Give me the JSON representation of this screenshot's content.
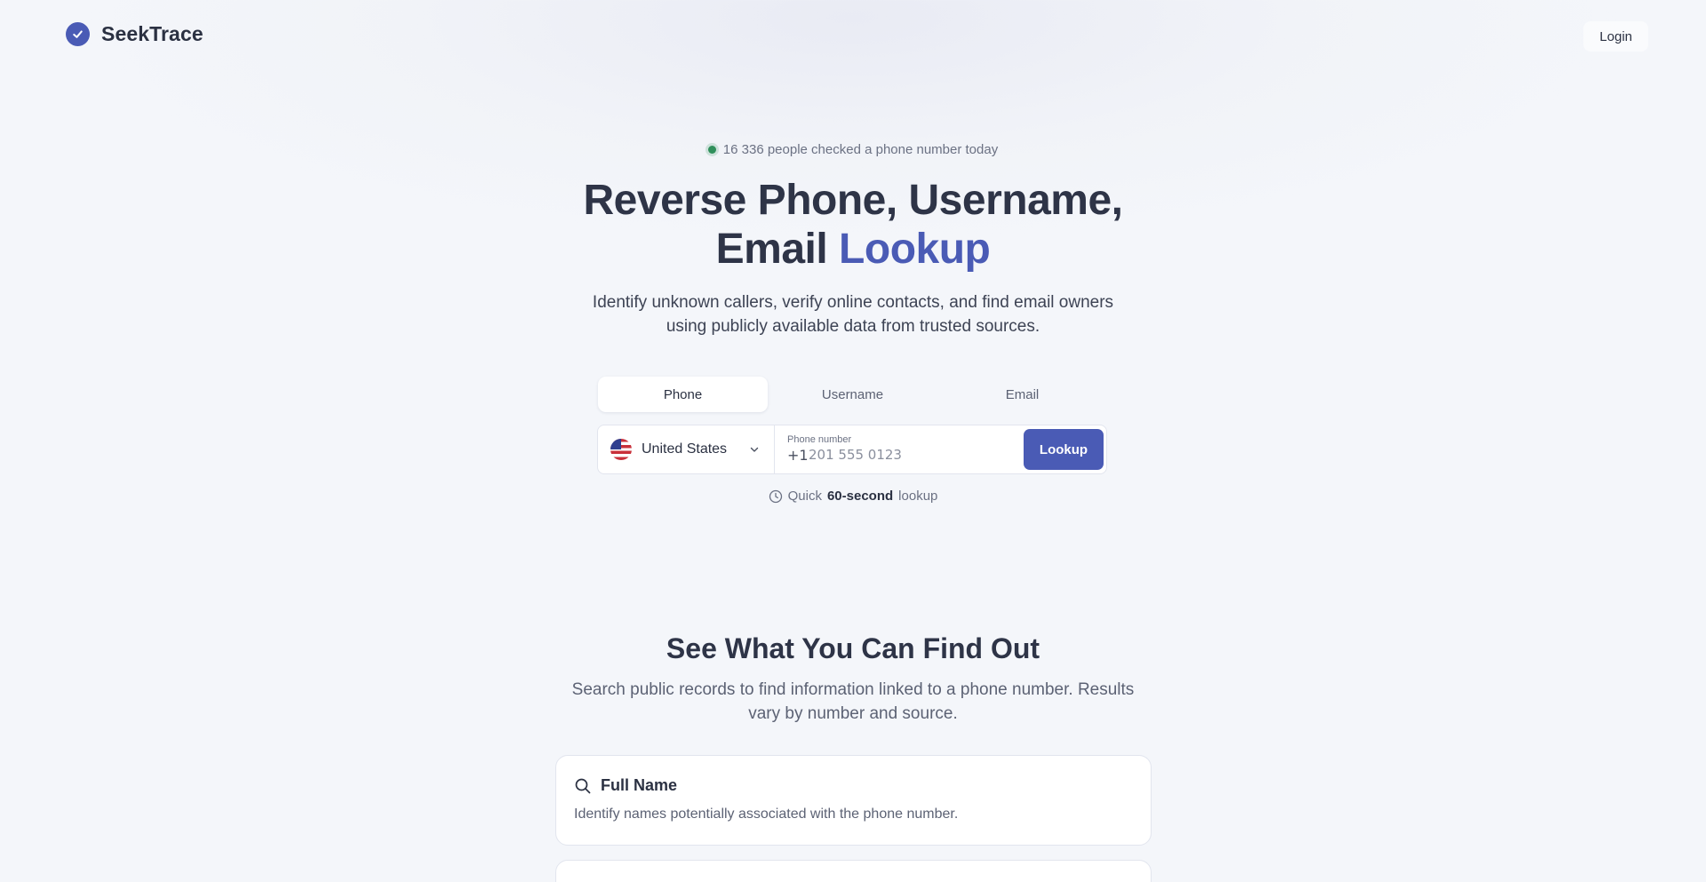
{
  "header": {
    "brand_name": "SeekTrace",
    "login_label": "Login"
  },
  "hero": {
    "badge_text": "16 336 people checked a phone number today",
    "title_main": "Reverse Phone, Username,",
    "title_line2_prefix": "Email",
    "title_accent": "Lookup",
    "subtitle": "Identify unknown callers, verify online contacts, and find email owners using publicly available data from trusted sources."
  },
  "tabs": [
    {
      "label": "Phone",
      "active": true
    },
    {
      "label": "Username",
      "active": false
    },
    {
      "label": "Email",
      "active": false
    }
  ],
  "search": {
    "country": "United States",
    "field_label": "Phone number",
    "prefix": "+1",
    "placeholder": "201 555 0123",
    "button_label": "Lookup"
  },
  "quick_note": {
    "prefix": "Quick",
    "emphasis": "60-second",
    "suffix": "lookup"
  },
  "section": {
    "title": "See What You Can Find Out",
    "subtitle": "Search public records to find information linked to a phone number. Results vary by number and source.",
    "cards": [
      {
        "icon": "search-icon",
        "title": "Full Name",
        "description": "Identify names potentially associated with the phone number."
      }
    ]
  },
  "colors": {
    "accent": "#4a5bb5",
    "status_dot": "#2f8f5b",
    "text_dark": "#2e3447"
  }
}
